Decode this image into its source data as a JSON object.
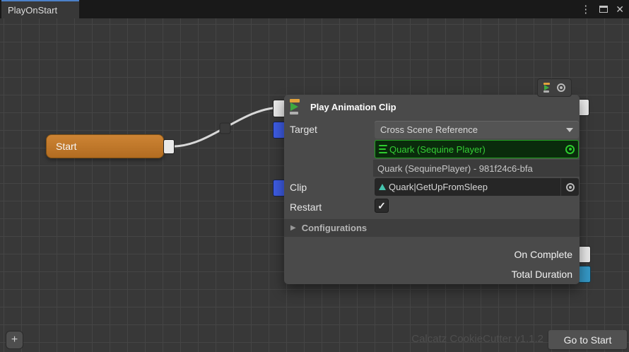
{
  "window": {
    "tab": "PlayOnStart",
    "menu_glyph": "⋮",
    "close_glyph": "✕"
  },
  "graph": {
    "start_node": {
      "label": "Start"
    },
    "play_animation_clip_node": {
      "title": "Play Animation Clip",
      "target": {
        "label": "Target",
        "dropdown_value": "Cross Scene Reference"
      },
      "reference": {
        "selected": "Quark (Sequine Player)",
        "id": "Quark (SequinePlayer) - 981f24c6-bfa"
      },
      "clip": {
        "label": "Clip",
        "value": "Quark|GetUpFromSleep"
      },
      "restart": {
        "label": "Restart",
        "checked": true,
        "check_glyph": "✓"
      },
      "configurations": {
        "label": "Configurations",
        "arrow_glyph": "▶",
        "expanded": false
      },
      "outputs": [
        {
          "label": "On Complete"
        },
        {
          "label": "Total Duration"
        }
      ]
    },
    "footer": {
      "watermark": "Calcatz CookieCutter v1.1.2",
      "go_to_start": "Go to Start",
      "add_button": "+"
    }
  },
  "colors": {
    "tab_accent": "#4C81C9",
    "start_node_orange": "#C0752B",
    "exec_port": "#E9E9E9",
    "data_port_blue": "#3D5BE0",
    "data_port_teal": "#3598C6",
    "reference_green": "#35CE35",
    "clip_icon_teal": "#45C4AE"
  }
}
